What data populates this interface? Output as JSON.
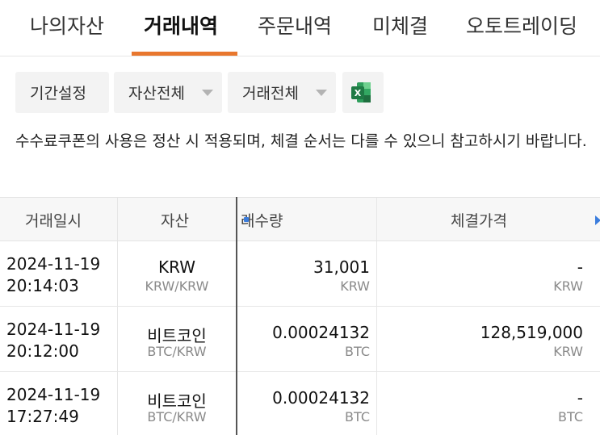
{
  "tabs": [
    {
      "label": "나의자산",
      "active": false
    },
    {
      "label": "거래내역",
      "active": true
    },
    {
      "label": "주문내역",
      "active": false
    },
    {
      "label": "미체결",
      "active": false
    },
    {
      "label": "오토트레이딩",
      "active": false
    }
  ],
  "filters": {
    "period": "기간설정",
    "asset": "자산전체",
    "trade": "거래전체",
    "excel_icon_letter": "X"
  },
  "notice": "수수료쿠폰의 사용은 정산 시 적용되며, 체결 순서는 다를 수 있으니 참고하시기 바랍니다.",
  "table": {
    "headers": {
      "date": "거래일시",
      "asset": "자산",
      "quantity": "래수량",
      "price": "체결가격"
    },
    "rows": [
      {
        "date": "2024-11-19",
        "time": "20:14:03",
        "asset": "KRW",
        "pair": "KRW/KRW",
        "quantity": "31,001",
        "quantity_unit": "KRW",
        "price": "-",
        "price_unit": "KRW"
      },
      {
        "date": "2024-11-19",
        "time": "20:12:00",
        "asset": "비트코인",
        "pair": "BTC/KRW",
        "quantity": "0.00024132",
        "quantity_unit": "BTC",
        "price": "128,519,000",
        "price_unit": "KRW"
      },
      {
        "date": "2024-11-19",
        "time": "17:27:49",
        "asset": "비트코인",
        "pair": "BTC/KRW",
        "quantity": "0.00024132",
        "quantity_unit": "BTC",
        "price": "-",
        "price_unit": "BTC"
      }
    ]
  },
  "colors": {
    "accent": "#e8772e",
    "header_bg": "#f7f7f7",
    "filter_bg": "#f3f3f3",
    "excel_green": "#1f7a45",
    "scroll_marker": "#3b7ddd"
  }
}
